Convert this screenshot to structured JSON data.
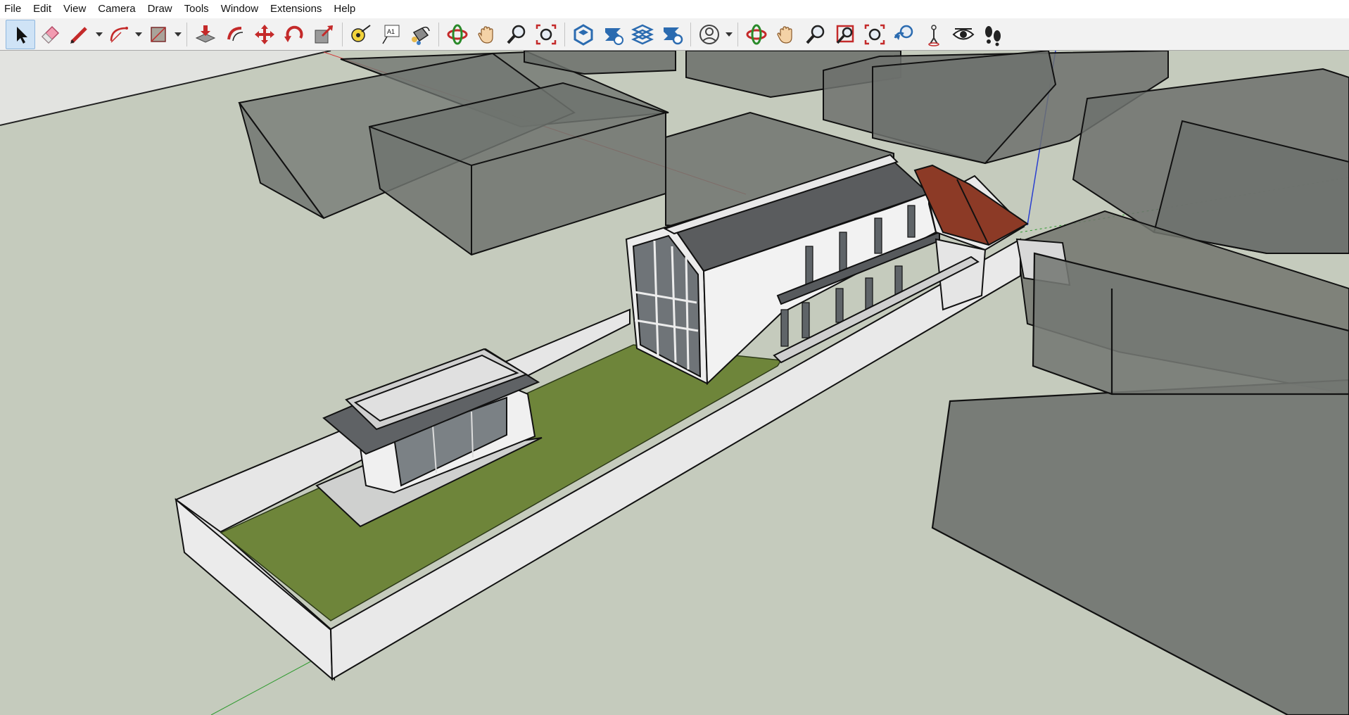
{
  "menu": [
    "File",
    "Edit",
    "View",
    "Camera",
    "Draw",
    "Tools",
    "Window",
    "Extensions",
    "Help"
  ],
  "toolbar": {
    "tools": [
      {
        "name": "select-tool-icon",
        "active": true
      },
      {
        "name": "eraser-tool-icon"
      },
      {
        "name": "pencil-line-tool-icon",
        "dropdown": true
      },
      {
        "name": "arc-tool-icon",
        "dropdown": true
      },
      {
        "name": "rectangle-tool-icon",
        "dropdown": true
      },
      {
        "separator": true
      },
      {
        "name": "push-pull-tool-icon"
      },
      {
        "name": "offset-tool-icon"
      },
      {
        "name": "move-tool-icon"
      },
      {
        "name": "rotate-tool-icon"
      },
      {
        "name": "scale-tool-icon"
      },
      {
        "separator": true
      },
      {
        "name": "tape-measure-tool-icon"
      },
      {
        "name": "text-tool-icon",
        "text": "A1"
      },
      {
        "name": "paint-bucket-tool-icon"
      },
      {
        "separator": true
      },
      {
        "name": "orbit-tool-icon"
      },
      {
        "name": "pan-tool-icon"
      },
      {
        "name": "zoom-tool-icon"
      },
      {
        "name": "zoom-extents-tool-icon"
      },
      {
        "separator": true
      },
      {
        "name": "3d-warehouse-icon"
      },
      {
        "name": "extension-warehouse-icon"
      },
      {
        "name": "layout-send-icon"
      },
      {
        "name": "extension-manager-icon"
      },
      {
        "separator": true
      },
      {
        "name": "account-icon",
        "dropdown": true
      },
      {
        "separator": true
      },
      {
        "name": "orbit-camera-icon"
      },
      {
        "name": "pan-camera-icon"
      },
      {
        "name": "zoom-camera-icon"
      },
      {
        "name": "zoom-window-icon"
      },
      {
        "name": "zoom-extents-camera-icon"
      },
      {
        "name": "previous-view-icon"
      },
      {
        "name": "position-camera-icon"
      },
      {
        "name": "look-around-icon"
      },
      {
        "name": "walk-icon"
      }
    ]
  },
  "colors": {
    "ground": "#c5cbbd",
    "sky": "#e2e3e0",
    "grass": "#6e853a",
    "wall_light": "#eeeeee",
    "wall_shade": "#dcdcdc",
    "context_block": "#767a76",
    "roof_metal": "#5d5f60",
    "roof_tile": "#8c3a26",
    "glass": "#7a8085",
    "axis_red": "#d23c3c",
    "axis_green": "#2e9a2e",
    "axis_blue": "#2a3fd0"
  }
}
